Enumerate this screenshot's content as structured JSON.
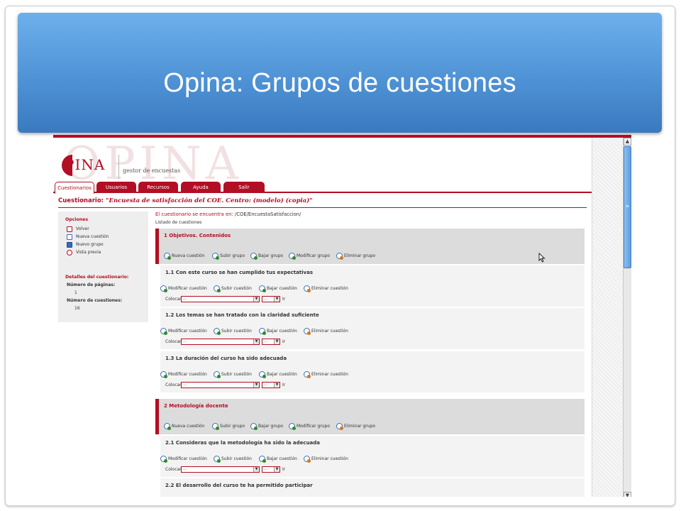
{
  "slide": {
    "title": "Opina: Grupos de cuestiones"
  },
  "logo": {
    "wordmark": "OPINA",
    "text": "PINA",
    "tagline": "gestor de encuestas"
  },
  "tabs": [
    {
      "label": "Cuestionarios",
      "active": true
    },
    {
      "label": "Usuarios",
      "active": false
    },
    {
      "label": "Recursos",
      "active": false
    },
    {
      "label": "Ayuda",
      "active": false
    },
    {
      "label": "Salir",
      "active": false
    }
  ],
  "questionnaire": {
    "label": "Cuestionario:",
    "name": "\"Encuesta de satisfacción del COE. Centro: (modelo) (copia)\""
  },
  "sidebar": {
    "options_heading": "Opciones",
    "options": [
      {
        "label": "Volver",
        "icon": "back-icon"
      },
      {
        "label": "Nueva cuestión",
        "icon": "new-question-icon"
      },
      {
        "label": "Nuevo grupo",
        "icon": "new-group-icon"
      },
      {
        "label": "Vista previa",
        "icon": "preview-icon"
      }
    ],
    "details_heading": "Detalles del cuestionario:",
    "pages_label": "Número de páginas:",
    "pages_value": "1",
    "questions_label": "Número de cuestiones:",
    "questions_value": "16"
  },
  "location": {
    "label": "El cuestionario se encuentra en:",
    "path": "/COE/EncuestaSatisfaccion/"
  },
  "list_title": "Listado de cuestiones",
  "group_actions": [
    "Nueva cuestión",
    "Subir grupo",
    "Bajar grupo",
    "Modificar grupo",
    "Eliminar grupo"
  ],
  "question_actions": [
    "Modificar cuestión",
    "Subir cuestión",
    "Bajar cuestión",
    "Eliminar cuestión"
  ],
  "colocar": {
    "label": "Colocar:",
    "select1": "...",
    "select2": "...",
    "go": "Ir"
  },
  "groups": [
    {
      "title": "1 Objetivos. Contenidos",
      "questions": [
        "1.1  Con este curso se han cumplido tus expectativas",
        "1.2  Los temas se han tratado con la claridad suficiente",
        "1.3  La duración del curso ha sido adecuada"
      ]
    },
    {
      "title": "2 Metodología docente",
      "questions": [
        "2.1  Consideras que la metodología ha sido la adecuada",
        "2.2  El desarrollo del curso te ha permitido participar"
      ]
    }
  ],
  "colors": {
    "brand_red": "#b20e24",
    "banner_blue": "#4f93d6"
  }
}
